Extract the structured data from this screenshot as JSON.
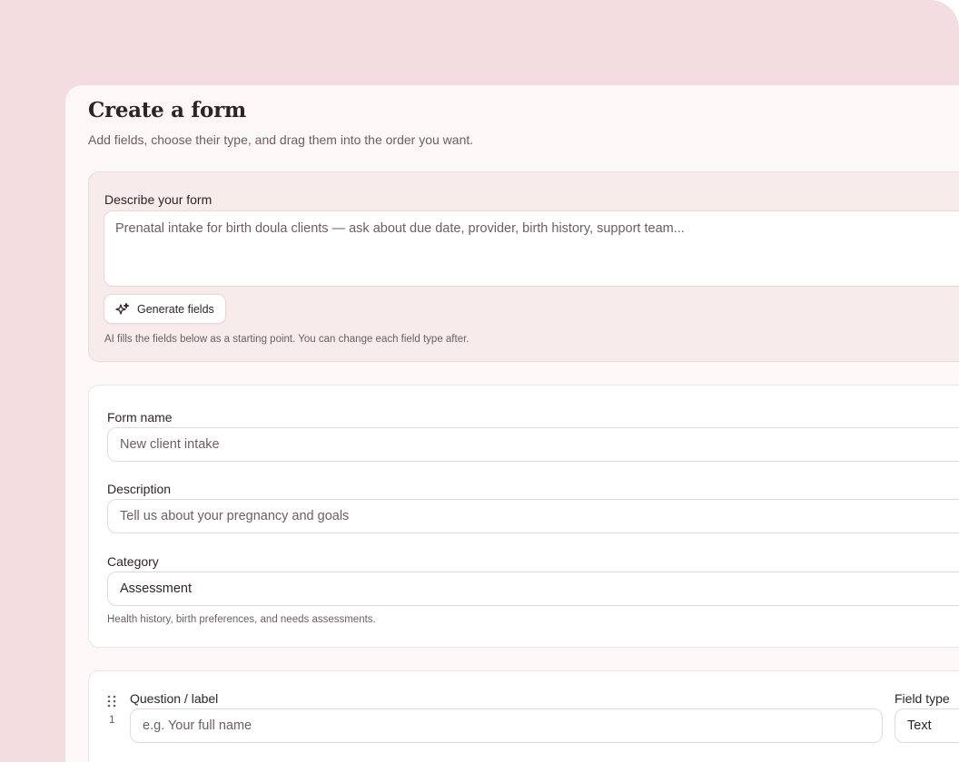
{
  "header": {
    "title": "Create a form",
    "subtitle": "Add fields, choose their type, and drag them into the order you want."
  },
  "ai": {
    "label": "Describe your form",
    "placeholder": "Prenatal intake for birth doula clients — ask about due date, provider, birth history, support team...",
    "generate_label": "Generate fields",
    "hint": "AI fills the fields below as a starting point. You can change each field type after."
  },
  "form": {
    "name_label": "Form name",
    "name_placeholder": "New client intake",
    "description_label": "Description",
    "description_placeholder": "Tell us about your pregnancy and goals",
    "category_label": "Category",
    "category_value": "Assessment",
    "category_hint": "Health history, birth preferences, and needs assessments."
  },
  "fields": [
    {
      "index": "1",
      "question_label": "Question / label",
      "question_placeholder": "e.g. Your full name",
      "type_label": "Field type",
      "type_value": "Text"
    }
  ],
  "colors": {
    "background": "#f3dde0",
    "panel": "#fcf8f7",
    "ai_card": "#f7ebeb",
    "text": "#2e2426",
    "muted": "#6e5d61"
  },
  "icons": {
    "generate": "sparkles-icon",
    "drag": "drag-handle-icon"
  }
}
